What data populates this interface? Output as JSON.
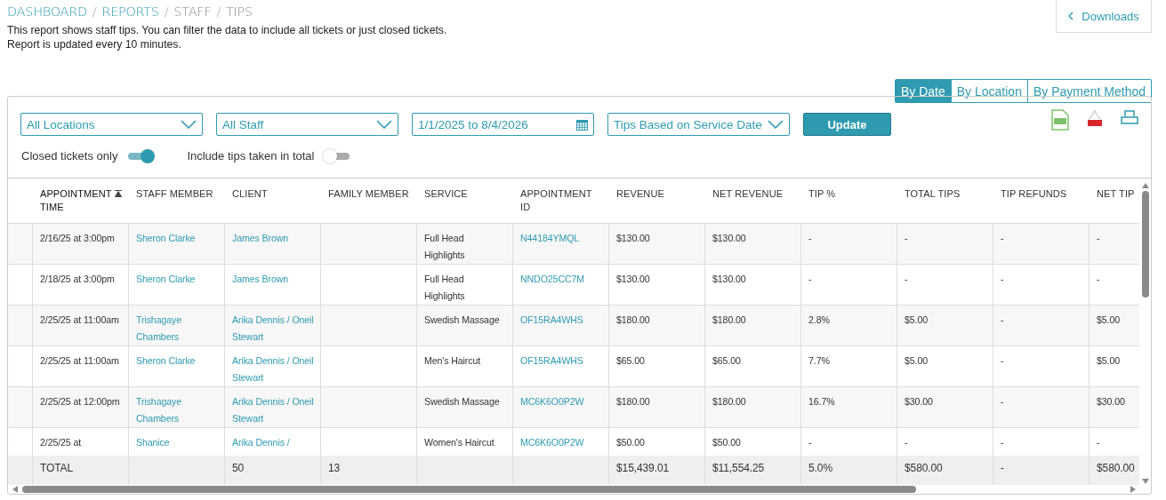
{
  "breadcrumb": {
    "separator": "/",
    "items": [
      {
        "label": "DASHBOARD",
        "link": true
      },
      {
        "label": "REPORTS",
        "link": true
      },
      {
        "label": "STAFF",
        "link": false
      },
      {
        "label": "TIPS",
        "link": false
      }
    ]
  },
  "description": [
    "This report shows staff tips. You can filter the data to include all tickets or just closed tickets.",
    "Report is updated every 10 minutes."
  ],
  "downloads": {
    "label": "Downloads"
  },
  "views": [
    {
      "label": "By Date",
      "selected": true
    },
    {
      "label": "By Location",
      "selected": false
    },
    {
      "label": "By Payment Method",
      "selected": false
    }
  ],
  "filters": {
    "location": "All Locations",
    "staff": "All Staff",
    "date_range": "1/1/2025 to 8/4/2026",
    "tips_basis": "Tips Based on Service Date",
    "update_button": "Update"
  },
  "toggles": [
    {
      "label": "Closed tickets only",
      "on": true
    },
    {
      "label": "Include tips taken in total",
      "on": false
    }
  ],
  "table": {
    "columns": [
      {
        "label": "APPOINTMENT TIME",
        "kind": "text",
        "sorted": true
      },
      {
        "label": "STAFF MEMBER",
        "kind": "link",
        "sorted": false
      },
      {
        "label": "CLIENT",
        "kind": "link",
        "sorted": false
      },
      {
        "label": "FAMILY MEMBER",
        "kind": "text",
        "sorted": false
      },
      {
        "label": "SERVICE",
        "kind": "text",
        "sorted": false
      },
      {
        "label": "APPOINTMENT ID",
        "kind": "link",
        "sorted": false
      },
      {
        "label": "REVENUE",
        "kind": "text",
        "sorted": false
      },
      {
        "label": "NET REVENUE",
        "kind": "text",
        "sorted": false
      },
      {
        "label": "TIP %",
        "kind": "text",
        "sorted": false
      },
      {
        "label": "TOTAL TIPS",
        "kind": "text",
        "sorted": false
      },
      {
        "label": "TIP REFUNDS",
        "kind": "text",
        "sorted": false
      },
      {
        "label": "NET TIP",
        "kind": "text",
        "sorted": false
      }
    ],
    "rows": [
      [
        {
          "text": "2/16/25 at 3:00pm"
        },
        {
          "text": "Sheron Clarke"
        },
        {
          "text": "James Brown"
        },
        {},
        {
          "text": "Full Head Highlights"
        },
        {
          "text": "N44184YMQL"
        },
        {
          "text": "$130.00"
        },
        {
          "text": "$130.00"
        },
        {
          "text": "-"
        },
        {
          "text": "-"
        },
        {
          "text": "-"
        },
        {
          "text": "-"
        }
      ],
      [
        {
          "text": "2/18/25 at 3:00pm"
        },
        {
          "text": "Sheron Clarke"
        },
        {
          "text": "James Brown"
        },
        {},
        {
          "text": "Full Head Highlights"
        },
        {
          "text": "NNDO25CC7M"
        },
        {
          "text": "$130.00"
        },
        {
          "text": "$130.00"
        },
        {
          "text": "-"
        },
        {
          "text": "-"
        },
        {
          "text": "-"
        },
        {
          "text": "-"
        }
      ],
      [
        {
          "text": "2/25/25 at 11:00am"
        },
        {
          "text": "Trishagaye Chambers"
        },
        {
          "text": "Arika Dennis / Oneil Stewart"
        },
        {},
        {
          "text": "Swedish Massage"
        },
        {
          "text": "OF15RA4WHS"
        },
        {
          "text": "$180.00"
        },
        {
          "text": "$180.00"
        },
        {
          "text": "2.8%"
        },
        {
          "text": "$5.00"
        },
        {
          "text": "-"
        },
        {
          "text": "$5.00"
        }
      ],
      [
        {
          "text": "2/25/25 at 11:00am"
        },
        {
          "text": "Sheron Clarke"
        },
        {
          "text": "Arika Dennis / Oneil Stewart"
        },
        {},
        {
          "text": "Men's Haircut"
        },
        {
          "text": "OF15RA4WHS"
        },
        {
          "text": "$65.00"
        },
        {
          "text": "$65.00"
        },
        {
          "text": "7.7%"
        },
        {
          "text": "$5.00"
        },
        {
          "text": "-"
        },
        {
          "text": "$5.00"
        }
      ],
      [
        {
          "text": "2/25/25 at 12:00pm"
        },
        {
          "text": "Trishagaye Chambers"
        },
        {
          "text": "Arika Dennis / Oneil Stewart"
        },
        {},
        {
          "text": "Swedish Massage"
        },
        {
          "text": "MC6K6O0P2W"
        },
        {
          "text": "$180.00"
        },
        {
          "text": "$180.00"
        },
        {
          "text": "16.7%"
        },
        {
          "text": "$30.00"
        },
        {
          "text": "-"
        },
        {
          "text": "$30.00"
        }
      ],
      [
        {
          "text": "2/25/25 at"
        },
        {
          "text": "Shanice"
        },
        {
          "text": "Arika Dennis /"
        },
        {},
        {
          "text": "Women's Haircut"
        },
        {
          "text": "MC6K6O0P2W"
        },
        {
          "text": "$50.00"
        },
        {
          "text": "$50.00"
        },
        {
          "text": "-"
        },
        {
          "text": "-"
        },
        {
          "text": "-"
        },
        {
          "text": "-"
        }
      ]
    ],
    "total": {
      "label": "TOTAL",
      "counts": [
        "50",
        "13"
      ],
      "amounts": [
        "$15,439.01",
        "$11,554.25",
        "5.0%",
        "$580.00",
        "-",
        "$580.00"
      ]
    }
  }
}
